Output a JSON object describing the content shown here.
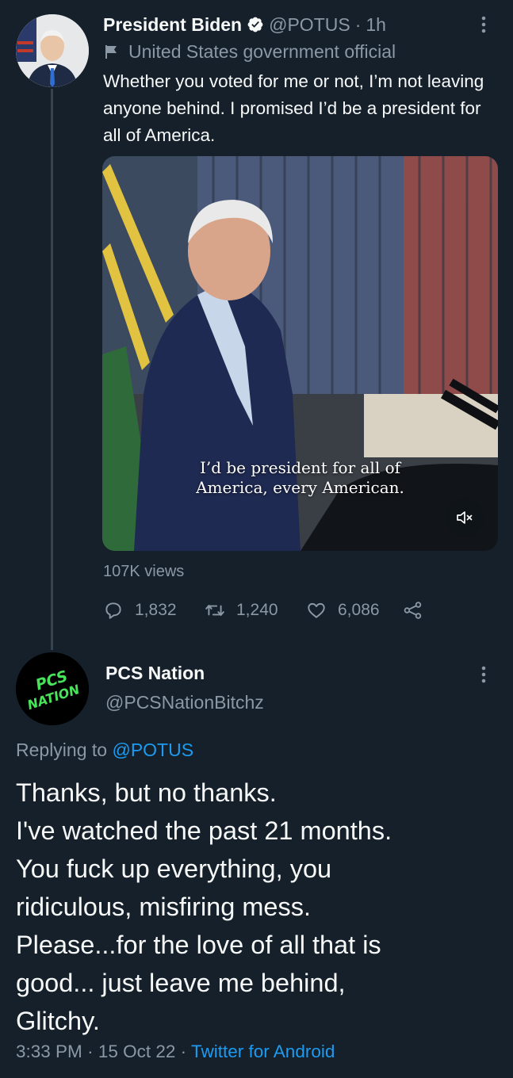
{
  "tweet": {
    "author_name": "President Biden",
    "handle": "@POTUS",
    "time_sep": "·",
    "time": "1h",
    "gov_label": "United States government official",
    "text": "Whether you voted for me or not, I’m not leaving anyone behind. I promised I’d be a president for all of America.",
    "media_caption_line1": "I’d be president for all of",
    "media_caption_line2": "America, every American.",
    "views": "107K views",
    "replies": "1,832",
    "retweets": "1,240",
    "likes": "6,086"
  },
  "reply": {
    "author_name": "PCS Nation",
    "handle": "@PCSNationBitchz",
    "avatar_text_line1": "PCS",
    "avatar_text_line2": "NATION",
    "replying_prefix": "Replying to",
    "replying_to": "@POTUS",
    "lines": [
      "Thanks, but no thanks.",
      "I've watched the past 21 months.",
      "You fuck up everything, you",
      "ridiculous, misfiring mess.",
      "Please...for the love of all that is",
      "good... just leave me behind,",
      "Glitchy."
    ],
    "time": "3:33 PM",
    "sep": "·",
    "date": "15 Oct 22",
    "client": "Twitter for Android"
  },
  "colors": {
    "background": "#15202b",
    "text": "#f7f9f9",
    "muted": "#8b98a5",
    "link": "#1d9bf0",
    "avatar_logo_green": "#46e35b"
  },
  "icons": [
    "verified-badge-icon",
    "flag-icon",
    "more-icon",
    "mute-icon",
    "reply-icon",
    "retweet-icon",
    "like-icon",
    "share-icon"
  ]
}
